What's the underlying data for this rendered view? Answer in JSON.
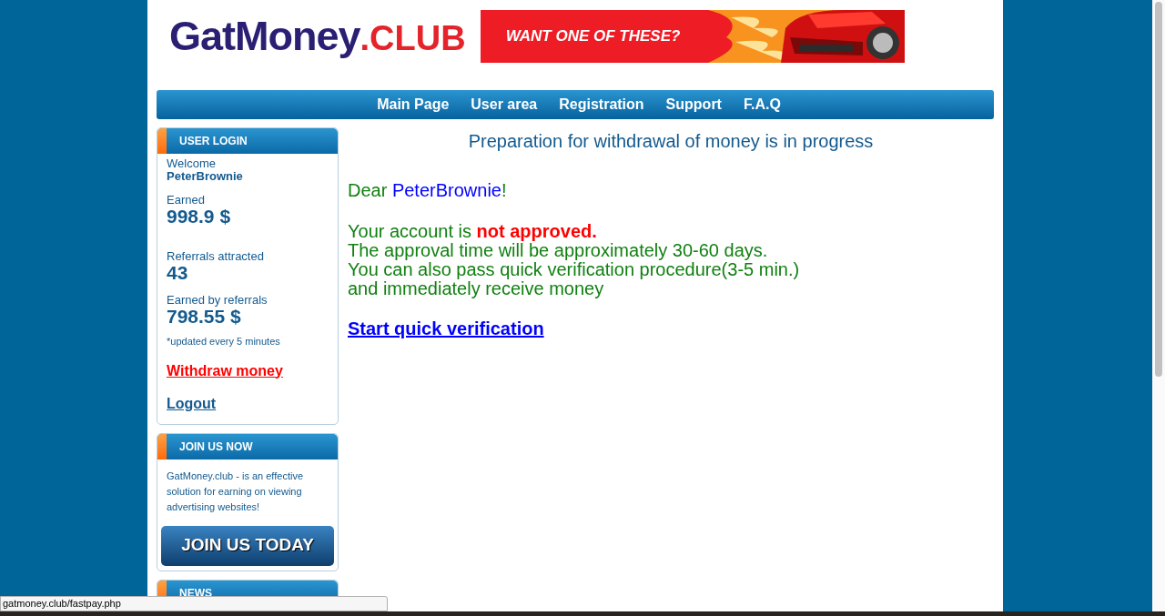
{
  "logo": {
    "name": "GatMoney",
    "suffix": ".CLUB"
  },
  "banner": {
    "text": "WANT ONE OF THESE?"
  },
  "nav": [
    "Main Page",
    "User area",
    "Registration",
    "Support",
    "F.A.Q"
  ],
  "user_login": {
    "title": "USER LOGIN",
    "welcome_label": "Welcome",
    "username": "PeterBrownie",
    "stats": [
      {
        "label": "Earned",
        "value": "998.9 $"
      },
      {
        "label": "Referrals attracted",
        "value": "43"
      },
      {
        "label": "Earned by referrals",
        "value": "798.55 $"
      }
    ],
    "note": "*updated every 5 minutes",
    "withdraw_link": "Withdraw money",
    "logout_link": "Logout"
  },
  "join": {
    "title": "JOIN US NOW",
    "text": "GatMoney.club - is an effective solution for earning on viewing advertising websites!",
    "button": "JOIN US TODAY"
  },
  "news": {
    "title": "NEWS"
  },
  "main": {
    "heading": "Preparation for withdrawal of money is in progress",
    "greeting": {
      "prefix": "Dear ",
      "name": "PeterBrownie",
      "suffix": "!"
    },
    "lines": [
      "Your account is **not approved.**",
      "The approval time will be approximately 30-60 days.",
      "You can also pass quick verification procedure(3-5 min.)",
      "and immediately receive money"
    ],
    "link": "Start quick verification"
  },
  "status_bar": {
    "url": "gatmoney.club/fastpay.php"
  }
}
